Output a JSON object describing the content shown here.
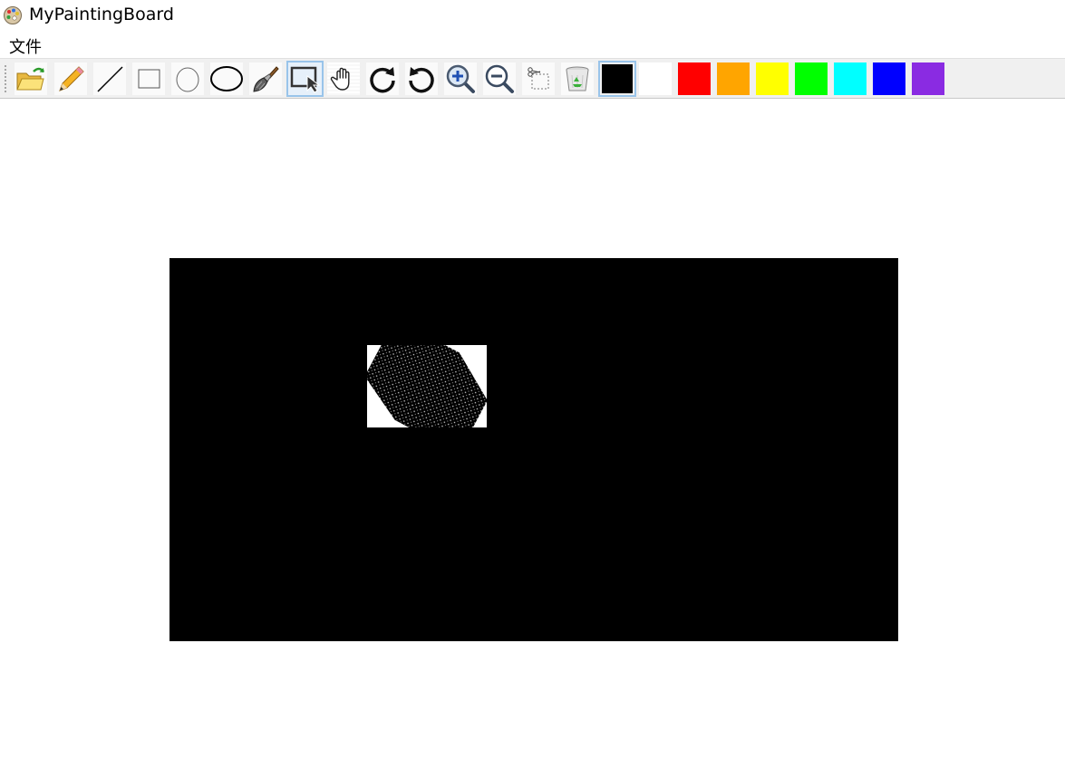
{
  "window": {
    "title": "MyPaintingBoard",
    "icon": "palette-icon"
  },
  "menu": {
    "items": [
      {
        "label": "文件"
      }
    ]
  },
  "toolbar": {
    "tools": [
      {
        "name": "open",
        "icon": "open-folder-icon"
      },
      {
        "name": "pencil",
        "icon": "pencil-icon"
      },
      {
        "name": "line",
        "icon": "line-icon"
      },
      {
        "name": "rectangle",
        "icon": "rectangle-icon"
      },
      {
        "name": "circle",
        "icon": "circle-icon"
      },
      {
        "name": "ellipse",
        "icon": "ellipse-icon"
      },
      {
        "name": "brush",
        "icon": "brush-icon"
      },
      {
        "name": "select",
        "icon": "select-cursor-icon",
        "active": true
      },
      {
        "name": "pan",
        "icon": "hand-icon"
      },
      {
        "name": "redo",
        "icon": "redo-icon"
      },
      {
        "name": "undo",
        "icon": "undo-icon"
      },
      {
        "name": "zoom-in",
        "icon": "zoom-in-icon"
      },
      {
        "name": "zoom-out",
        "icon": "zoom-out-icon"
      },
      {
        "name": "cut",
        "icon": "scissors-icon"
      },
      {
        "name": "clear",
        "icon": "recycle-bin-icon"
      }
    ],
    "colors": [
      {
        "name": "black",
        "hex": "#000000",
        "selected": true
      },
      {
        "name": "white",
        "hex": "#ffffff"
      },
      {
        "name": "red",
        "hex": "#ff0000"
      },
      {
        "name": "orange",
        "hex": "#ffa500"
      },
      {
        "name": "yellow",
        "hex": "#ffff00"
      },
      {
        "name": "green",
        "hex": "#00ff00"
      },
      {
        "name": "cyan",
        "hex": "#00ffff"
      },
      {
        "name": "blue",
        "hex": "#0000ff"
      },
      {
        "name": "purple",
        "hex": "#8a2be2"
      }
    ]
  },
  "canvas": {
    "background": "#ffffff",
    "image_fill": "#000000"
  }
}
